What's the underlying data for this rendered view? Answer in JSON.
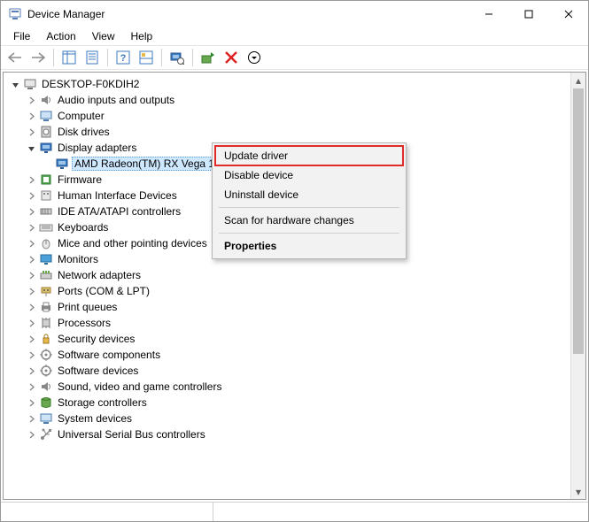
{
  "window": {
    "title": "Device Manager"
  },
  "menu": {
    "file": "File",
    "action": "Action",
    "view": "View",
    "help": "Help"
  },
  "toolbar": {
    "back": "Back",
    "forward": "Forward",
    "show_hide": "Show/Hide console tree",
    "properties": "Properties",
    "help": "Help",
    "action_view": "Action view",
    "scan": "Scan for hardware changes",
    "update": "Update driver",
    "uninstall": "Uninstall device",
    "more": "More actions"
  },
  "tree": {
    "root": "DESKTOP-F0KDIH2",
    "items": [
      {
        "label": "Audio inputs and outputs",
        "icon": "audio"
      },
      {
        "label": "Computer",
        "icon": "computer"
      },
      {
        "label": "Disk drives",
        "icon": "disk"
      },
      {
        "label": "Display adapters",
        "icon": "display",
        "expanded": true,
        "children": [
          {
            "label": "AMD Radeon(TM) RX Vega 11 Graphics",
            "icon": "display",
            "selected": true
          }
        ]
      },
      {
        "label": "Firmware",
        "icon": "firmware"
      },
      {
        "label": "Human Interface Devices",
        "icon": "hid"
      },
      {
        "label": "IDE ATA/ATAPI controllers",
        "icon": "ide"
      },
      {
        "label": "Keyboards",
        "icon": "keyboard"
      },
      {
        "label": "Mice and other pointing devices",
        "icon": "mouse"
      },
      {
        "label": "Monitors",
        "icon": "monitor"
      },
      {
        "label": "Network adapters",
        "icon": "network"
      },
      {
        "label": "Ports (COM & LPT)",
        "icon": "ports"
      },
      {
        "label": "Print queues",
        "icon": "print"
      },
      {
        "label": "Processors",
        "icon": "cpu"
      },
      {
        "label": "Security devices",
        "icon": "security"
      },
      {
        "label": "Software components",
        "icon": "software"
      },
      {
        "label": "Software devices",
        "icon": "software"
      },
      {
        "label": "Sound, video and game controllers",
        "icon": "sound"
      },
      {
        "label": "Storage controllers",
        "icon": "storage"
      },
      {
        "label": "System devices",
        "icon": "system"
      },
      {
        "label": "Universal Serial Bus controllers",
        "icon": "usb"
      }
    ]
  },
  "context_menu": {
    "items": [
      {
        "label": "Update driver",
        "highlight": true
      },
      {
        "label": "Disable device"
      },
      {
        "label": "Uninstall device"
      },
      {
        "sep": true
      },
      {
        "label": "Scan for hardware changes"
      },
      {
        "sep": true
      },
      {
        "label": "Properties",
        "bold": true
      }
    ]
  }
}
